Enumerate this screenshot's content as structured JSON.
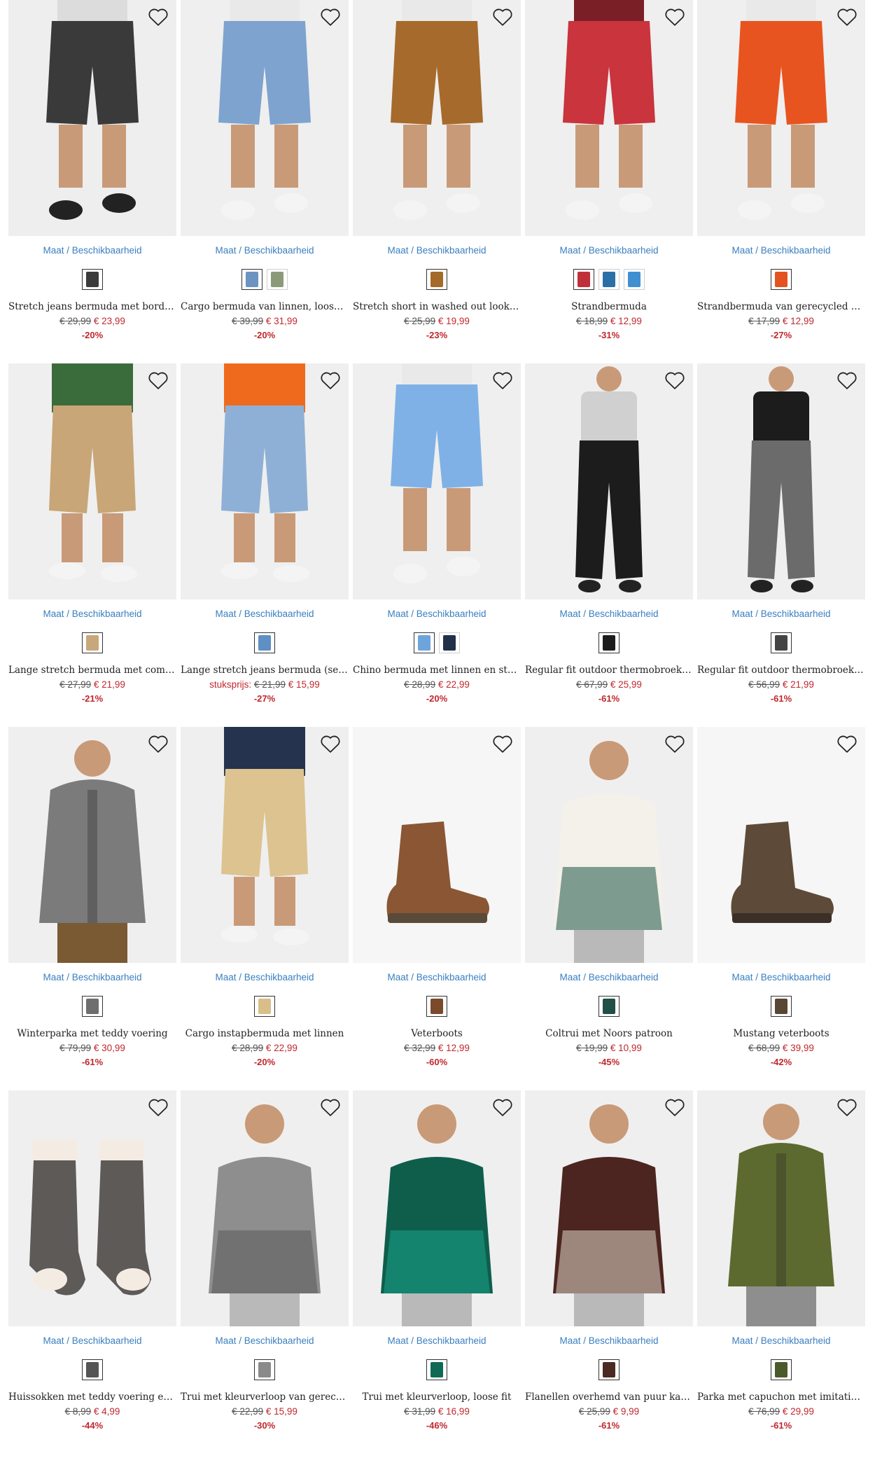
{
  "availability_label": "Maat / Beschikbaarheid",
  "products": [
    {
      "title": "Stretch jeans bermuda met borduu…",
      "old": "€ 29,99",
      "new": "€ 23,99",
      "disc": "-20%",
      "unit": "",
      "bg": "#eeeeee",
      "swatches": [
        "#3b3b3b"
      ],
      "shape": "shorts",
      "c1": "#3a3a3a",
      "c2": "#dcdcdc"
    },
    {
      "title": "Cargo bermuda van linnen, loose fit",
      "old": "€ 39,99",
      "new": "€ 31,99",
      "disc": "-20%",
      "unit": "",
      "bg": "#efefef",
      "swatches": [
        "#6d93c0",
        "#8d9a7a"
      ],
      "shape": "shorts",
      "c1": "#7ea3cf",
      "c2": "#ffffff"
    },
    {
      "title": "Stretch short in washed out look, r…",
      "old": "€ 25,99",
      "new": "€ 19,99",
      "disc": "-23%",
      "unit": "",
      "bg": "#efefef",
      "swatches": [
        "#a36a2a"
      ],
      "shape": "shorts",
      "c1": "#a66a2c",
      "c2": "#ffffff"
    },
    {
      "title": "Strandbermuda",
      "old": "€ 18,99",
      "new": "€ 12,99",
      "disc": "-31%",
      "unit": "",
      "bg": "#efefef",
      "swatches": [
        "#c0303a",
        "#2a6fa8",
        "#3f8fd1"
      ],
      "shape": "shorts",
      "c1": "#c9343d",
      "c2": "#7a1f26"
    },
    {
      "title": "Strandbermuda van gerecycled pol…",
      "old": "€ 17,99",
      "new": "€ 12,99",
      "disc": "-27%",
      "unit": "",
      "bg": "#efefef",
      "swatches": [
        "#e4521f"
      ],
      "shape": "shorts",
      "c1": "#e8541f",
      "c2": "#ffffff"
    },
    {
      "title": "Lange stretch bermuda met comfor…",
      "old": "€ 27,99",
      "new": "€ 21,99",
      "disc": "-21%",
      "unit": "",
      "bg": "#efefef",
      "swatches": [
        "#c8a77a"
      ],
      "shape": "capri",
      "c1": "#c9a677",
      "c2": "#3a6b3a"
    },
    {
      "title": "Lange stretch jeans bermuda (set v…",
      "old": "€ 21,99",
      "new": "€ 15,99",
      "disc": "-27%",
      "unit": "stuksprijs:",
      "bg": "#efefef",
      "swatches": [
        "#5f8fc4"
      ],
      "shape": "capri",
      "c1": "#8fb0d6",
      "c2": "#f06a1d"
    },
    {
      "title": "Chino bermuda met linnen en strik…",
      "old": "€ 28,99",
      "new": "€ 22,99",
      "disc": "-20%",
      "unit": "",
      "bg": "#efefef",
      "swatches": [
        "#6fa3dc",
        "#23304a"
      ],
      "shape": "shorts",
      "c1": "#7fb1e6",
      "c2": "#ffffff"
    },
    {
      "title": "Regular fit outdoor thermobroek …",
      "old": "€ 67,99",
      "new": "€ 25,99",
      "disc": "-61%",
      "unit": "",
      "bg": "#efefef",
      "swatches": [
        "#1c1c1c"
      ],
      "shape": "pants",
      "c1": "#1c1c1c",
      "c2": "#d0d0d0"
    },
    {
      "title": "Regular fit outdoor thermobroek …",
      "old": "€ 56,99",
      "new": "€ 21,99",
      "disc": "-61%",
      "unit": "",
      "bg": "#efefef",
      "swatches": [
        "#444444"
      ],
      "shape": "pants",
      "c1": "#6b6b6b",
      "c2": "#1c1c1c"
    },
    {
      "title": "Winterparka met teddy voering",
      "old": "€ 79,99",
      "new": "€ 30,99",
      "disc": "-61%",
      "unit": "",
      "bg": "#efefef",
      "swatches": [
        "#6e6e6e"
      ],
      "shape": "coat",
      "c1": "#7b7b7b",
      "c2": "#7a5a33"
    },
    {
      "title": "Cargo instapbermuda met linnen",
      "old": "€ 28,99",
      "new": "€ 22,99",
      "disc": "-20%",
      "unit": "",
      "bg": "#efefef",
      "swatches": [
        "#d8bf8a"
      ],
      "shape": "capri",
      "c1": "#dcc38f",
      "c2": "#25334e"
    },
    {
      "title": "Veterboots",
      "old": "€ 32,99",
      "new": "€ 12,99",
      "disc": "-60%",
      "unit": "",
      "bg": "#f6f6f6",
      "swatches": [
        "#7a4a2a"
      ],
      "shape": "boot",
      "c1": "#8a5633",
      "c2": "#5a4a3a"
    },
    {
      "title": "Coltrui met Noors patroon",
      "old": "€ 19,99",
      "new": "€ 10,99",
      "disc": "-45%",
      "unit": "",
      "bg": "#efefef",
      "swatches": [
        "#1f4f45"
      ],
      "shape": "sweater",
      "c1": "#f3f1ea",
      "c2": "#1e5446"
    },
    {
      "title": "Mustang veterboots",
      "old": "€ 68,99",
      "new": "€ 39,99",
      "disc": "-42%",
      "unit": "",
      "bg": "#f6f6f6",
      "swatches": [
        "#5a4634"
      ],
      "shape": "boot",
      "c1": "#5d4a38",
      "c2": "#3a3028"
    },
    {
      "title": "Huissokken met teddy voering en s…",
      "old": "€ 8,99",
      "new": "€ 4,99",
      "disc": "-44%",
      "unit": "",
      "bg": "#efefef",
      "swatches": [
        "#555555"
      ],
      "shape": "socks",
      "c1": "#5e5a57",
      "c2": "#f4ece2"
    },
    {
      "title": "Trui met kleurverloop van gerecycl…",
      "old": "€ 22,99",
      "new": "€ 15,99",
      "disc": "-30%",
      "unit": "",
      "bg": "#efefef",
      "swatches": [
        "#8a8a8a"
      ],
      "shape": "sweater",
      "c1": "#8e8e8e",
      "c2": "#5a5a5a"
    },
    {
      "title": "Trui met kleurverloop, loose fit",
      "old": "€ 31,99",
      "new": "€ 16,99",
      "disc": "-46%",
      "unit": "",
      "bg": "#efefef",
      "swatches": [
        "#0e6a55"
      ],
      "shape": "sweater",
      "c1": "#0f5e4c",
      "c2": "#1aa48a"
    },
    {
      "title": "Flanellen overhemd van puur katoe…",
      "old": "€ 25,99",
      "new": "€ 9,99",
      "disc": "-61%",
      "unit": "",
      "bg": "#efefef",
      "swatches": [
        "#4a2a22"
      ],
      "shape": "sweater",
      "c1": "#4c2520",
      "c2": "#e0d8c8"
    },
    {
      "title": "Parka met capuchon met imitatieb…",
      "old": "€ 76,99",
      "new": "€ 29,99",
      "disc": "-61%",
      "unit": "",
      "bg": "#efefef",
      "swatches": [
        "#4a5a2a"
      ],
      "shape": "coat",
      "c1": "#5d6a2f",
      "c2": "#8e8e8e"
    }
  ]
}
